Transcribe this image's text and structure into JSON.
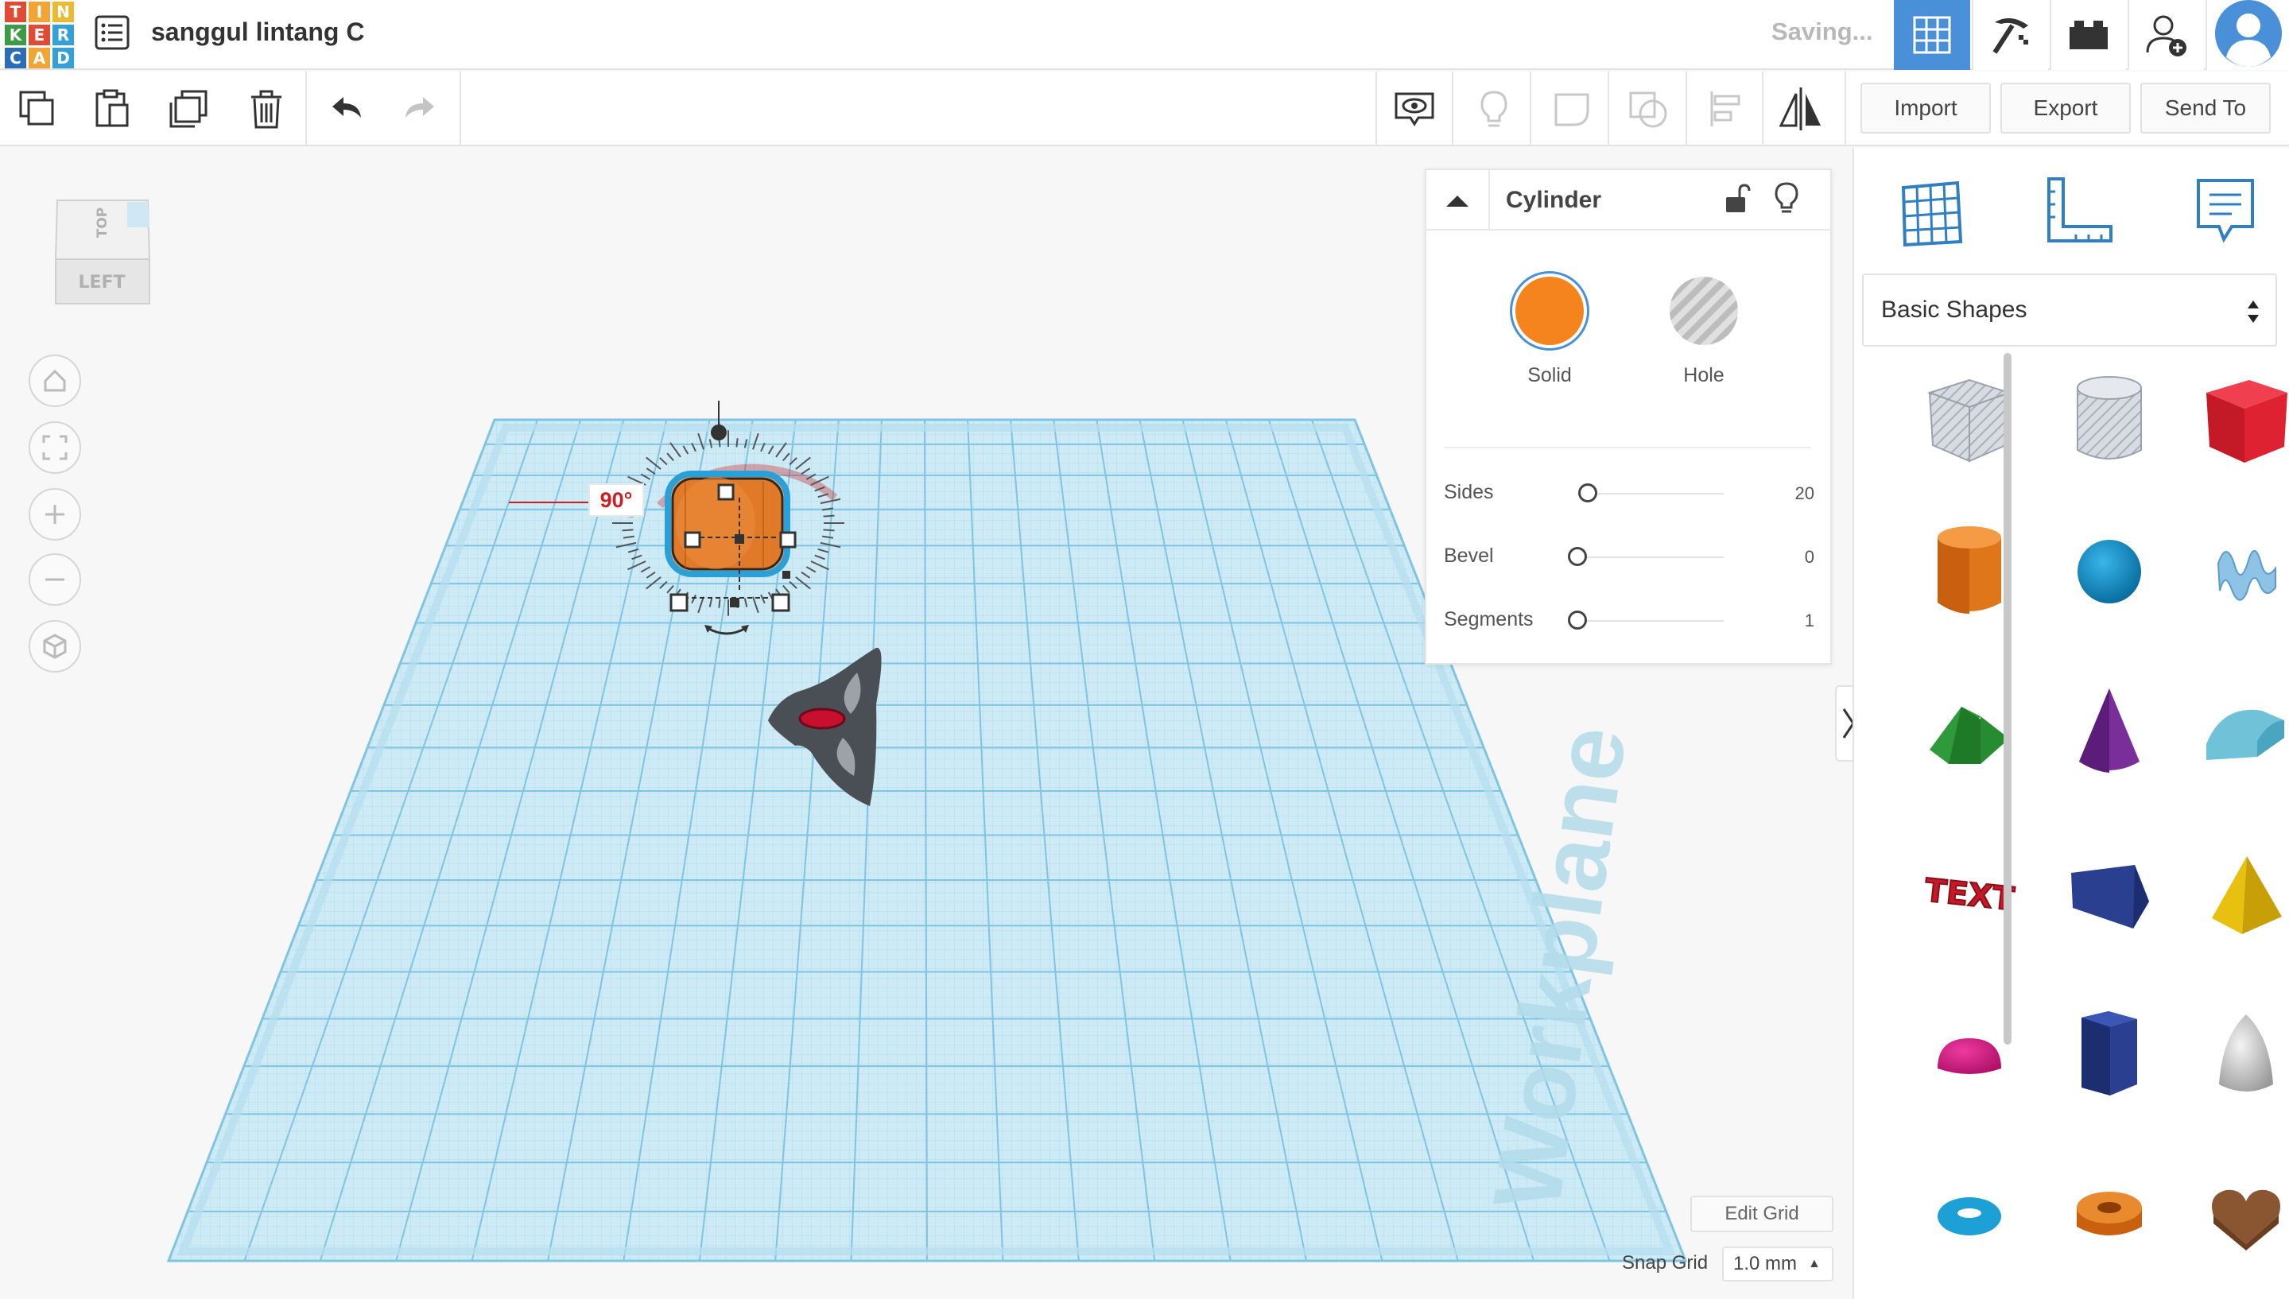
{
  "app": {
    "logo_letters": [
      "T",
      "I",
      "N",
      "K",
      "E",
      "R",
      "C",
      "A",
      "D"
    ],
    "logo_colors": [
      "#e14b35",
      "#f2a434",
      "#e9bb35",
      "#3e9b45",
      "#e14b35",
      "#33a0d9",
      "#2c6bb5",
      "#f2a434",
      "#33a0d9"
    ],
    "design_title": "sanggul lintang C",
    "save_status": "Saving...",
    "accent": "#4a90d9"
  },
  "topnav": {
    "items": [
      {
        "name": "3d-design-view",
        "icon": "grid-icon",
        "active": true
      },
      {
        "name": "blocks-view",
        "icon": "pickaxe-icon",
        "active": false
      },
      {
        "name": "bricks-view",
        "icon": "brick-icon",
        "active": false
      },
      {
        "name": "invite-user",
        "icon": "add-user-icon",
        "active": false
      },
      {
        "name": "account",
        "icon": "avatar-icon",
        "active": false
      }
    ]
  },
  "toolbar": {
    "copy_icon": "copy-icon",
    "paste_icon": "paste-icon",
    "duplicate_icon": "duplicate-icon",
    "delete_icon": "trash-icon",
    "undo_icon": "undo-icon",
    "redo_icon": "redo-icon",
    "right_icons": [
      "eye-icon",
      "lightbulb-icon",
      "group-icon",
      "ungroup-icon",
      "align-icon",
      "mirror-icon"
    ],
    "import_label": "Import",
    "export_label": "Export",
    "sendto_label": "Send To"
  },
  "viewcube": {
    "face_front": "LEFT",
    "face_top": "TOP"
  },
  "viewport": {
    "rotation_value": "90°",
    "workplane_label": "Workplane",
    "edit_grid_label": "Edit Grid",
    "snap_grid_label": "Snap Grid",
    "snap_grid_value": "1.0 mm"
  },
  "inspector": {
    "shape_name": "Cylinder",
    "solid_label": "Solid",
    "hole_label": "Hole",
    "solid_color": "#f5841f",
    "properties": [
      {
        "label": "Sides",
        "value": "20",
        "fraction": 0.07
      },
      {
        "label": "Bevel",
        "value": "0",
        "fraction": 0.0
      },
      {
        "label": "Segments",
        "value": "1",
        "fraction": 0.0
      }
    ]
  },
  "shapes_panel": {
    "selected_category": "Basic Shapes",
    "shapes": [
      {
        "name": "box-hole"
      },
      {
        "name": "cylinder-hole"
      },
      {
        "name": "box"
      },
      {
        "name": "cylinder"
      },
      {
        "name": "sphere"
      },
      {
        "name": "scribble"
      },
      {
        "name": "roof"
      },
      {
        "name": "cone"
      },
      {
        "name": "round-roof"
      },
      {
        "name": "text"
      },
      {
        "name": "wedge"
      },
      {
        "name": "pyramid"
      },
      {
        "name": "half-sphere"
      },
      {
        "name": "polygon"
      },
      {
        "name": "paraboloid"
      },
      {
        "name": "torus"
      },
      {
        "name": "tube"
      },
      {
        "name": "heart"
      }
    ]
  }
}
